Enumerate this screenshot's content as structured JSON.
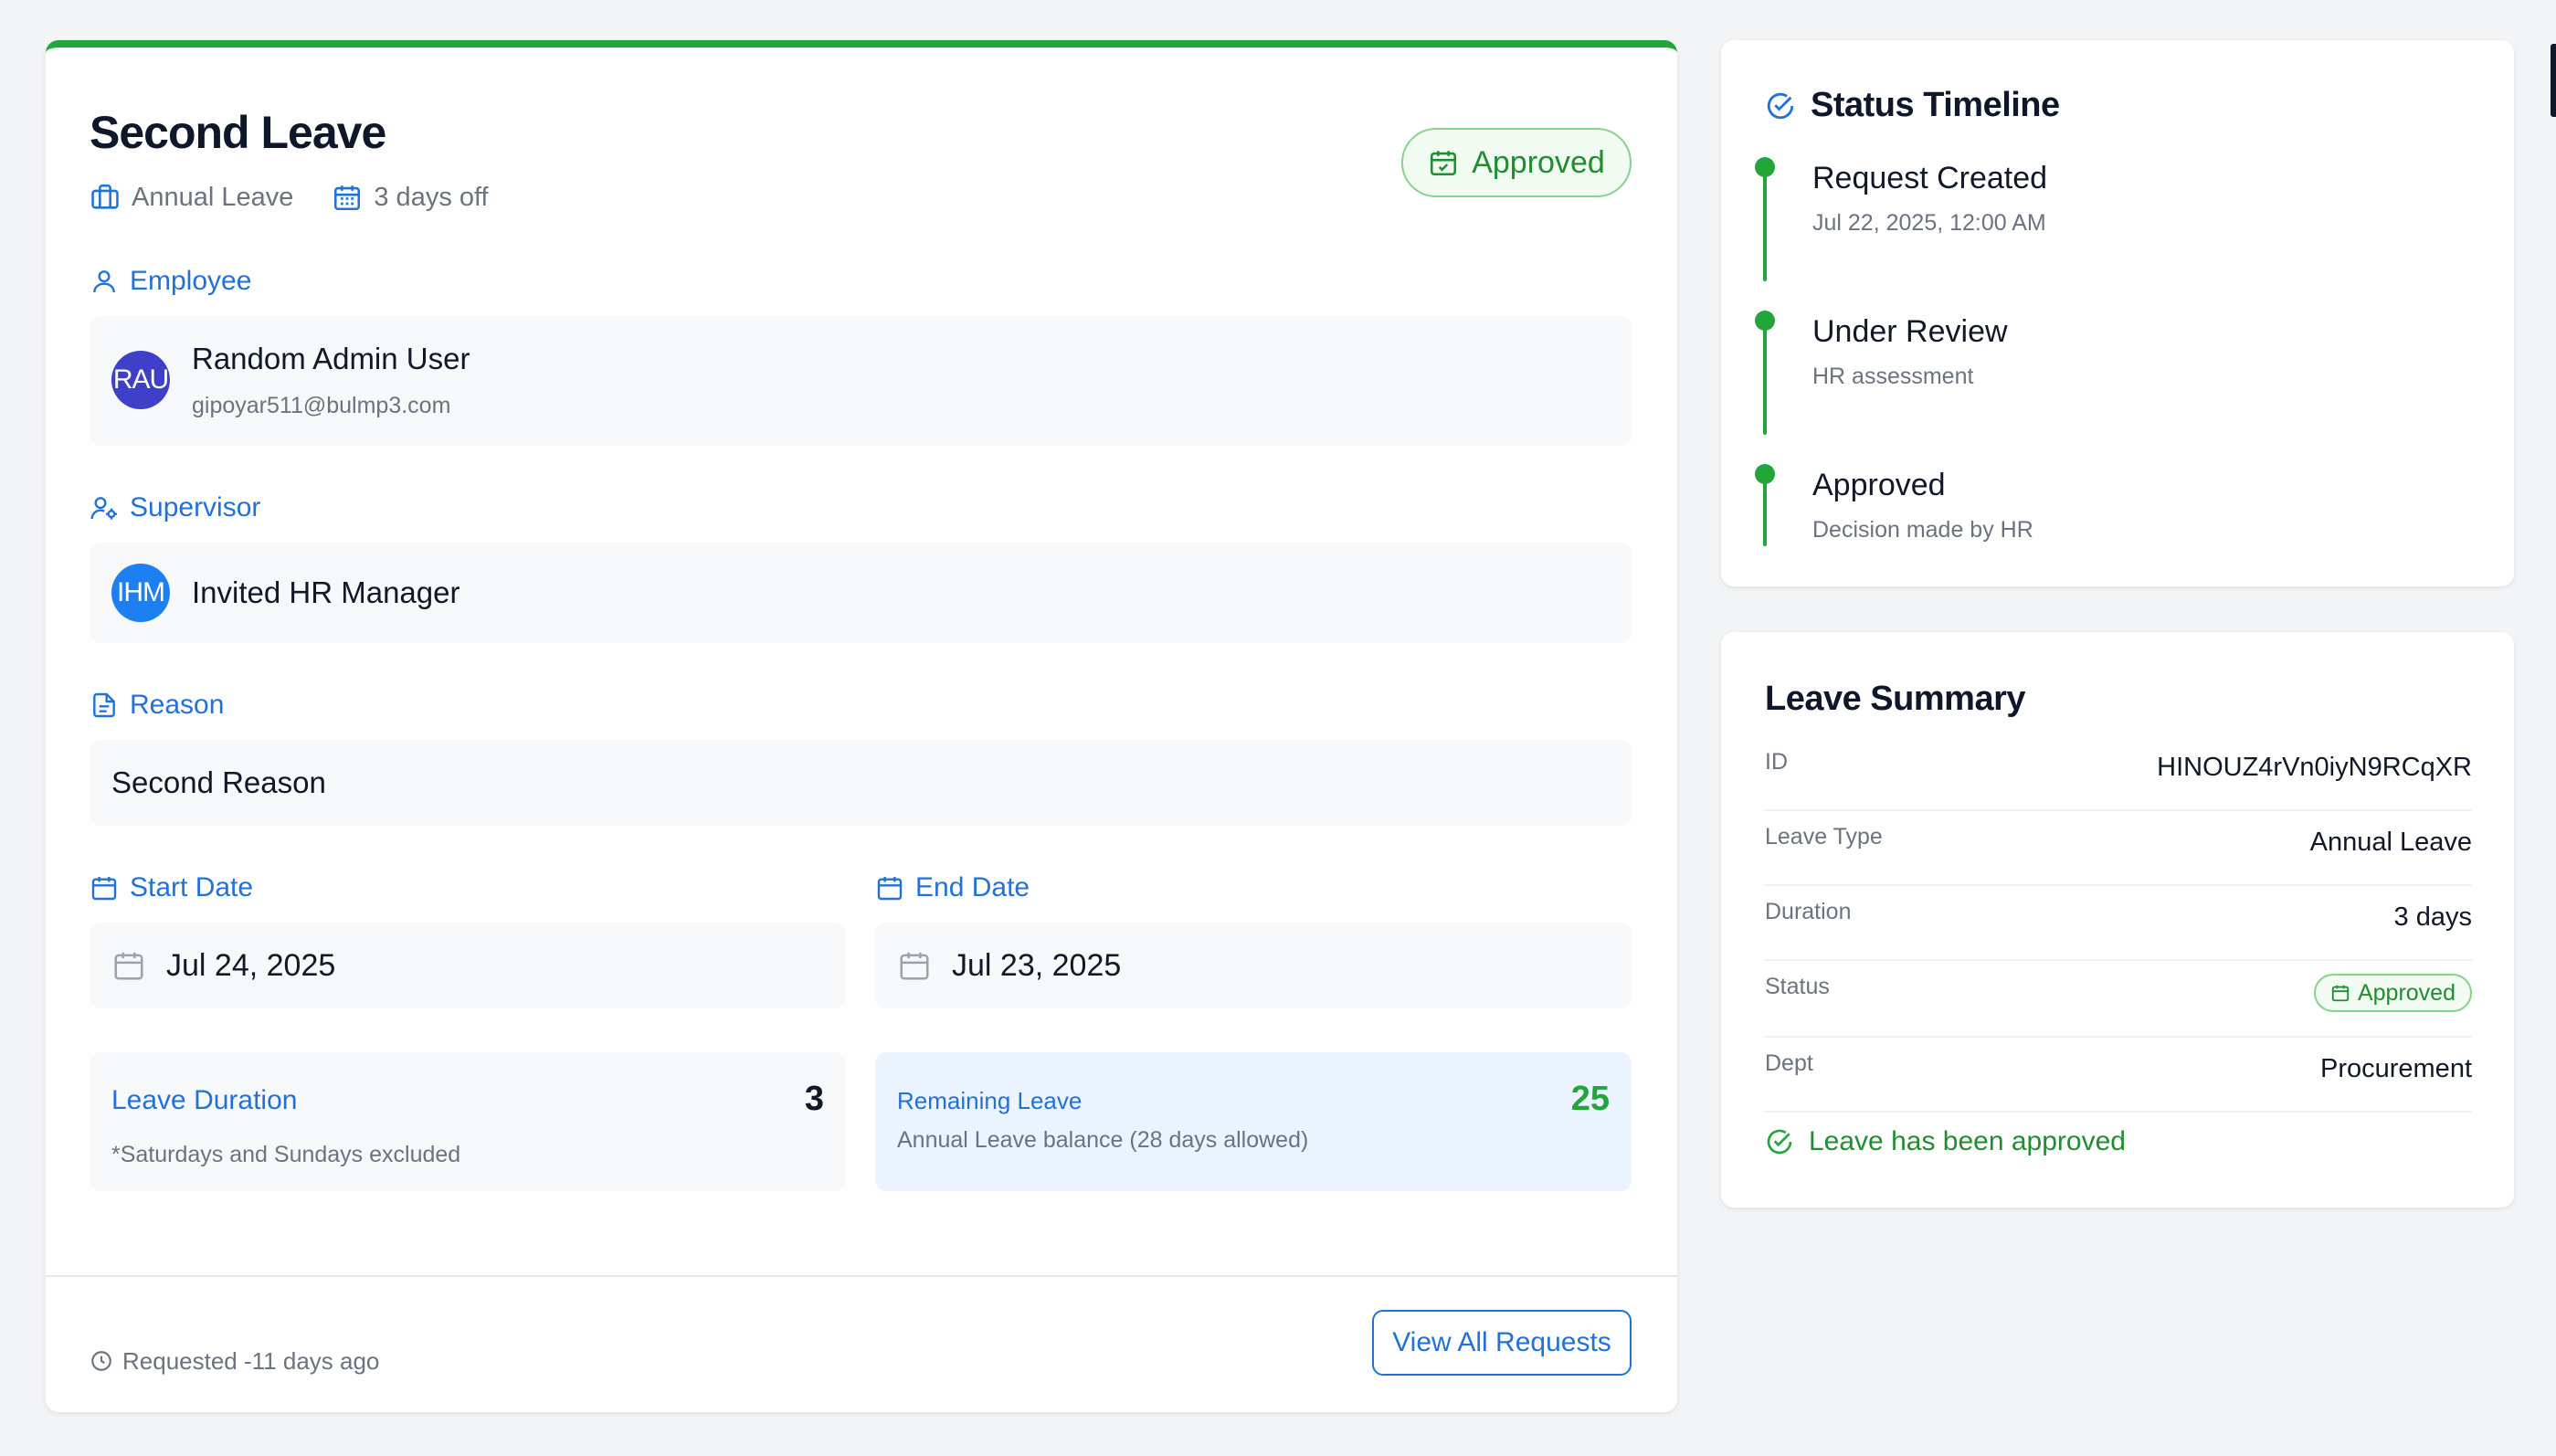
{
  "request": {
    "title": "Second Leave",
    "leave_type": "Annual Leave",
    "days_off": "3 days off",
    "status": "Approved"
  },
  "employee": {
    "label": "Employee",
    "initials": "RAU",
    "name": "Random Admin User",
    "email": "gipoyar511@bulmp3.com",
    "avatar_color": "#3f3fc9"
  },
  "supervisor": {
    "label": "Supervisor",
    "initials": "IHM",
    "name": "Invited HR Manager",
    "avatar_color": "#1e80f0"
  },
  "reason": {
    "label": "Reason",
    "text": "Second Reason"
  },
  "dates": {
    "start_label": "Start Date",
    "start_value": "Jul 24, 2025",
    "end_label": "End Date",
    "end_value": "Jul 23, 2025"
  },
  "duration": {
    "label": "Leave Duration",
    "value": "3",
    "note": "*Saturdays and Sundays excluded"
  },
  "remaining": {
    "label": "Remaining Leave",
    "value": "25",
    "note": "Annual Leave balance (28 days allowed)"
  },
  "footer": {
    "requested": "Requested -11 days ago",
    "view_all": "View All Requests"
  },
  "timeline": {
    "title": "Status Timeline",
    "steps": [
      {
        "title": "Request Created",
        "sub": "Jul 22, 2025, 12:00 AM"
      },
      {
        "title": "Under Review",
        "sub": "HR assessment"
      },
      {
        "title": "Approved",
        "sub": "Decision made by HR"
      }
    ]
  },
  "summary": {
    "title": "Leave Summary",
    "rows": [
      {
        "key": "ID",
        "value": "HINOUZ4rVn0iyN9RCqXR"
      },
      {
        "key": "Leave Type",
        "value": "Annual Leave"
      },
      {
        "key": "Duration",
        "value": "3 days"
      },
      {
        "key": "Status",
        "value": "Approved"
      },
      {
        "key": "Dept",
        "value": "Procurement"
      }
    ],
    "note": "Leave has been approved"
  },
  "colors": {
    "accent_green": "#22a63a",
    "accent_blue": "#2271d8",
    "remaining_bg": "#ebf3fe"
  }
}
